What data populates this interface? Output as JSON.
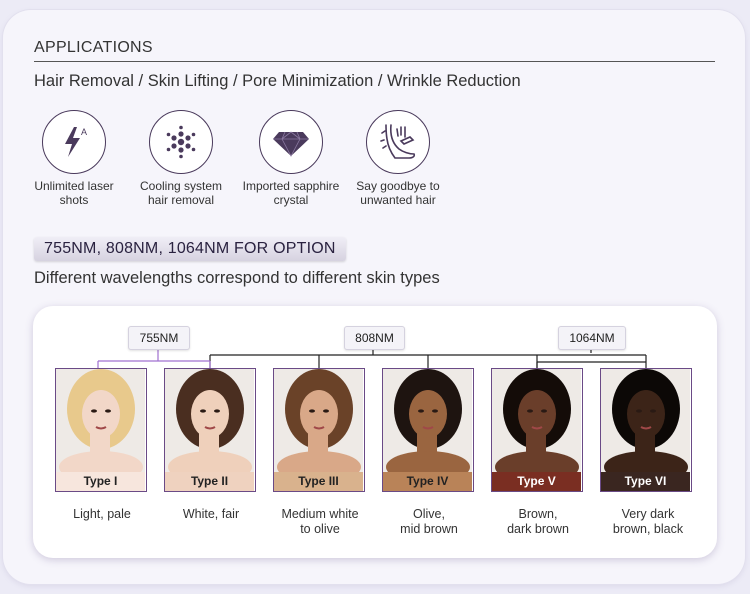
{
  "title": "APPLICATIONS",
  "subtitle": "Hair Removal / Skin Lifting / Pore Minimization / Wrinkle Reduction",
  "features": [
    {
      "icon": "lightning-icon",
      "label": "Unlimited laser\nshots"
    },
    {
      "icon": "snowflake-icon",
      "label": "Cooling system\nhair removal"
    },
    {
      "icon": "diamond-icon",
      "label": "Imported sapphire\ncrystal"
    },
    {
      "icon": "leg-hair-icon",
      "label": "Say goodbye to\nunwanted hair"
    }
  ],
  "wavelength_badge": "755NM, 808NM, 1064NM FOR OPTION",
  "wavelength_sub": "Different wavelengths correspond to different skin types",
  "wavelength_tags": [
    "755NM",
    "808NM",
    "1064NM"
  ],
  "skin_types": [
    {
      "type": "Type I",
      "desc": "Light, pale",
      "label_bg": "#f7e6dd",
      "label_color": "#222",
      "skin_tone": "#f2d7c8",
      "hair": "#e8c98c"
    },
    {
      "type": "Type II",
      "desc": "White, fair",
      "label_bg": "#efd2bf",
      "label_color": "#222",
      "skin_tone": "#efd0bb",
      "hair": "#4a2e20"
    },
    {
      "type": "Type III",
      "desc": "Medium white\nto olive",
      "label_bg": "#d9b28d",
      "label_color": "#222",
      "skin_tone": "#d9a888",
      "hair": "#6a4228"
    },
    {
      "type": "Type IV",
      "desc": "Olive,\nmid brown",
      "label_bg": "#b98358",
      "label_color": "#222",
      "skin_tone": "#9a6540",
      "hair": "#1e1410"
    },
    {
      "type": "Type V",
      "desc": "Brown,\ndark brown",
      "label_bg": "#7a2e22",
      "label_color": "#ffffff",
      "skin_tone": "#6a3e2a",
      "hair": "#140c08"
    },
    {
      "type": "Type VI",
      "desc": "Very dark\nbrown, black",
      "label_bg": "#3a2620",
      "label_color": "#ffffff",
      "skin_tone": "#3c2418",
      "hair": "#0c0806"
    }
  ],
  "colors": {
    "accent": "#4a3a5c",
    "icon_fill": "#4a3a5c",
    "bracket_755": "#a070d0",
    "bracket": "#222222"
  }
}
